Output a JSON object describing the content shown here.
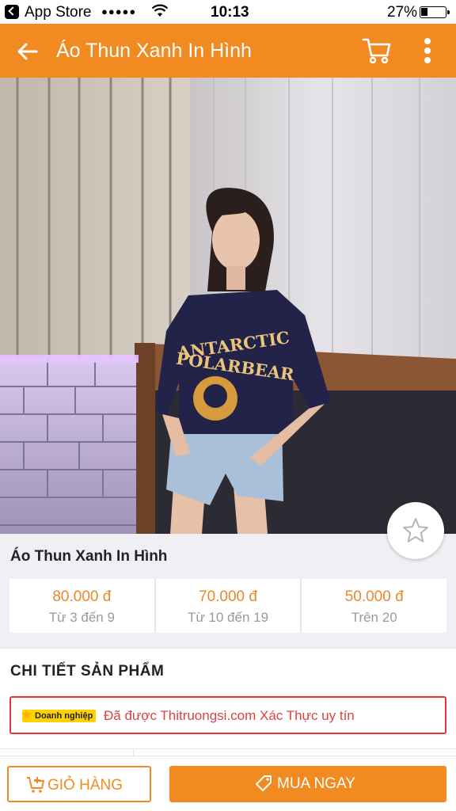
{
  "status_bar": {
    "carrier": "App Store",
    "signal": "●●●●●",
    "time": "10:13",
    "battery_text": "27%",
    "battery_level": 0.27
  },
  "header": {
    "title": "Áo Thun Xanh In Hình",
    "back_icon": "arrow-left-icon",
    "cart_icon": "cart-icon",
    "more_icon": "more-vertical-icon"
  },
  "product": {
    "image_print_line1": "ANTARCTIC",
    "image_print_line2": "POLARBEAR",
    "name": "Áo Thun Xanh In Hình",
    "prices": [
      {
        "price": "80.000 đ",
        "range": "Từ 3 đến 9"
      },
      {
        "price": "70.000 đ",
        "range": "Từ 10 đến 19"
      },
      {
        "price": "50.000 đ",
        "range": "Trên 20"
      }
    ]
  },
  "details": {
    "title": "CHI TIẾT SẢN PHẨM",
    "badge": "Doanh nghiệp",
    "verify_text": "Đã được Thitruongsi.com Xác Thực uy tín"
  },
  "bottom_bar": {
    "cart_label": "GIỎ HÀNG",
    "buy_label": "MUA NGAY"
  },
  "colors": {
    "accent": "#f28a22",
    "price": "#e8892b",
    "verify_red": "#d84444"
  }
}
